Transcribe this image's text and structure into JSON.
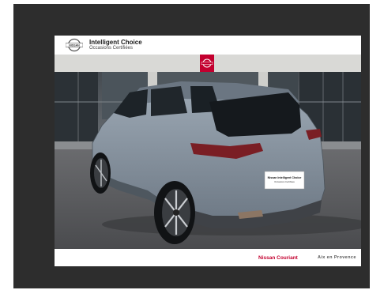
{
  "header": {
    "logo_text": "NISSAN",
    "title": "Intelligent Choice",
    "subtitle": "Occasions Certifiées"
  },
  "plate": {
    "title": "Nissan Intelligent Choice",
    "subtitle": "Occasions Certifiées"
  },
  "footer": {
    "dealer": "Nissan Couriant",
    "city": "Aix en Provence"
  },
  "colors": {
    "frame": "#2d2d2d",
    "brand_red": "#c3002f",
    "car_body": "#7f8c99",
    "asphalt": "#55565a"
  },
  "icons": {
    "brand_logo": "nissan-logo-icon",
    "dealer_sign": "nissan-sign-icon"
  }
}
